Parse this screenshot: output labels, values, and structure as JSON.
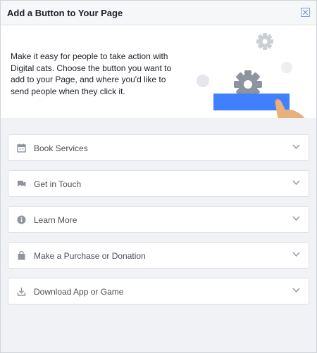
{
  "dialog": {
    "title": "Add a Button to Your Page",
    "close_icon": "close-icon"
  },
  "intro": {
    "text": "Make it easy for people to take action with Digital cats. Choose the button you want to add to your Page, and where you'd like to send people when they click it."
  },
  "options": [
    {
      "label": "Book Services",
      "icon": "calendar-icon"
    },
    {
      "label": "Get in Touch",
      "icon": "chat-icon"
    },
    {
      "label": "Learn More",
      "icon": "info-icon"
    },
    {
      "label": "Make a Purchase or Donation",
      "icon": "shopping-bag-icon"
    },
    {
      "label": "Download App or Game",
      "icon": "download-icon"
    }
  ],
  "colors": {
    "accent": "#4080ff",
    "header_bg": "#f6f7f9",
    "page_bg": "#f1f2f5"
  }
}
